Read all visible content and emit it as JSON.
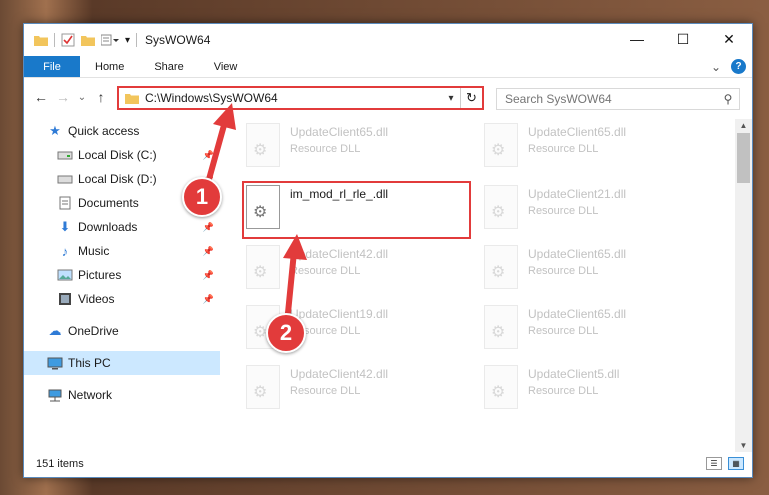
{
  "window": {
    "title": "SysWOW64",
    "controls": {
      "minimize": "—",
      "maximize": "☐",
      "close": "✕"
    }
  },
  "ribbon": {
    "tabs": [
      "File",
      "Home",
      "Share",
      "View"
    ],
    "expand": "⌄",
    "help": "?"
  },
  "nav": {
    "back": "←",
    "forward": "→",
    "recent": "⌄",
    "up": "↑",
    "address": "C:\\Windows\\SysWOW64",
    "refresh": "↻",
    "search_placeholder": "Search SysWOW64"
  },
  "sidebar": {
    "items": [
      {
        "label": "Quick access",
        "icon": "star-icon"
      },
      {
        "label": "Local Disk (C:)",
        "icon": "drive-icon",
        "pinned": true
      },
      {
        "label": "Local Disk (D:)",
        "icon": "drive-icon",
        "pinned": true
      },
      {
        "label": "Documents",
        "icon": "documents-icon",
        "pinned": true
      },
      {
        "label": "Downloads",
        "icon": "downloads-icon",
        "pinned": true
      },
      {
        "label": "Music",
        "icon": "music-icon",
        "pinned": true
      },
      {
        "label": "Pictures",
        "icon": "pictures-icon",
        "pinned": true
      },
      {
        "label": "Videos",
        "icon": "videos-icon",
        "pinned": true
      },
      {
        "label": "OneDrive",
        "icon": "cloud-icon"
      },
      {
        "label": "This PC",
        "icon": "computer-icon",
        "selected": true
      },
      {
        "label": "Network",
        "icon": "network-icon"
      }
    ]
  },
  "files": [
    {
      "name": "UpdateClient65.dll",
      "type": "Resource DLL"
    },
    {
      "name": "UpdateClient65.dll",
      "type": "Resource DLL"
    },
    {
      "name": "im_mod_rl_rle_.dll",
      "type": ""
    },
    {
      "name": "UpdateClient21.dll",
      "type": "Resource DLL"
    },
    {
      "name": "UpdateClient42.dll",
      "type": "Resource DLL"
    },
    {
      "name": "UpdateClient65.dll",
      "type": "Resource DLL"
    },
    {
      "name": "UpdateClient19.dll",
      "type": "Resource DLL"
    },
    {
      "name": "UpdateClient65.dll",
      "type": "Resource DLL"
    },
    {
      "name": "UpdateClient42.dll",
      "type": "Resource DLL"
    },
    {
      "name": "UpdateClient5.dll",
      "type": "Resource DLL"
    }
  ],
  "status": {
    "count": "151 items"
  },
  "callouts": [
    "1",
    "2"
  ],
  "colors": {
    "accent": "#1979ca",
    "highlight": "#e23b3b",
    "selected": "#cce8ff"
  }
}
